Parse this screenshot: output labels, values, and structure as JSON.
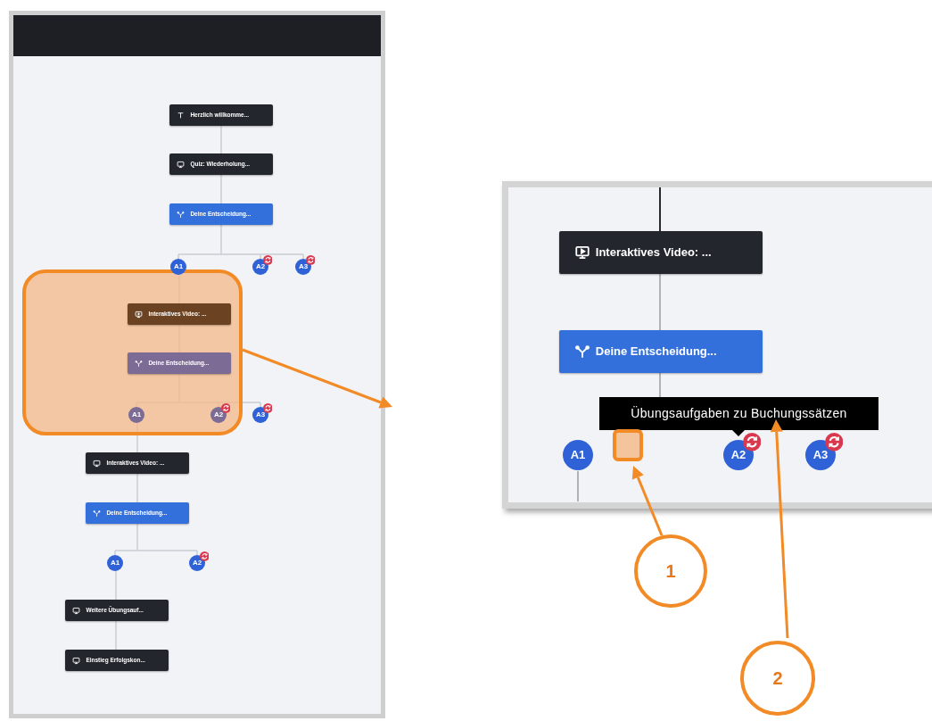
{
  "overview": {
    "nodes": [
      {
        "label": "Herzlich willkomme...",
        "kind": "content",
        "highlighted": false
      },
      {
        "label": "Quiz: Wiederholung...",
        "kind": "content",
        "highlighted": false
      },
      {
        "label": "Deine Entscheidung...",
        "kind": "branching",
        "highlighted": false
      },
      {
        "label": "Interaktives Video: ...",
        "kind": "content",
        "highlighted": true
      },
      {
        "label": "Deine Entscheidung...",
        "kind": "branching",
        "highlighted": true
      },
      {
        "label": "Interaktives Video: ...",
        "kind": "content",
        "highlighted": false
      },
      {
        "label": "Deine Entscheidung...",
        "kind": "branching",
        "highlighted": false
      },
      {
        "label": "Weitere Übungsauf...",
        "kind": "content",
        "highlighted": false
      },
      {
        "label": "Einstieg Erfolgskon...",
        "kind": "content",
        "highlighted": false
      }
    ],
    "answer_groups": [
      [
        {
          "label": "A1",
          "loop": false,
          "highlighted": false
        },
        {
          "label": "A2",
          "loop": true,
          "highlighted": false
        },
        {
          "label": "A3",
          "loop": true,
          "highlighted": false
        }
      ],
      [
        {
          "label": "A1",
          "loop": false,
          "highlighted": true
        },
        {
          "label": "A2",
          "loop": true,
          "highlighted": true
        },
        {
          "label": "A3",
          "loop": true,
          "highlighted": false
        }
      ],
      [
        {
          "label": "A1",
          "loop": false,
          "highlighted": false
        },
        {
          "label": "A2",
          "loop": true,
          "highlighted": false
        }
      ]
    ]
  },
  "detail": {
    "nodes": [
      {
        "label": "Interaktives Video: ...",
        "kind": "content"
      },
      {
        "label": "Deine Entscheidung...",
        "kind": "branching"
      }
    ],
    "tooltip": "Übungsaufgaben zu Buchungssätzen",
    "answers": [
      {
        "label": "A1",
        "loop": false
      },
      {
        "label": "A2",
        "loop": true
      },
      {
        "label": "A3",
        "loop": true
      }
    ]
  },
  "callouts": [
    {
      "label": "1"
    },
    {
      "label": "2"
    }
  ]
}
